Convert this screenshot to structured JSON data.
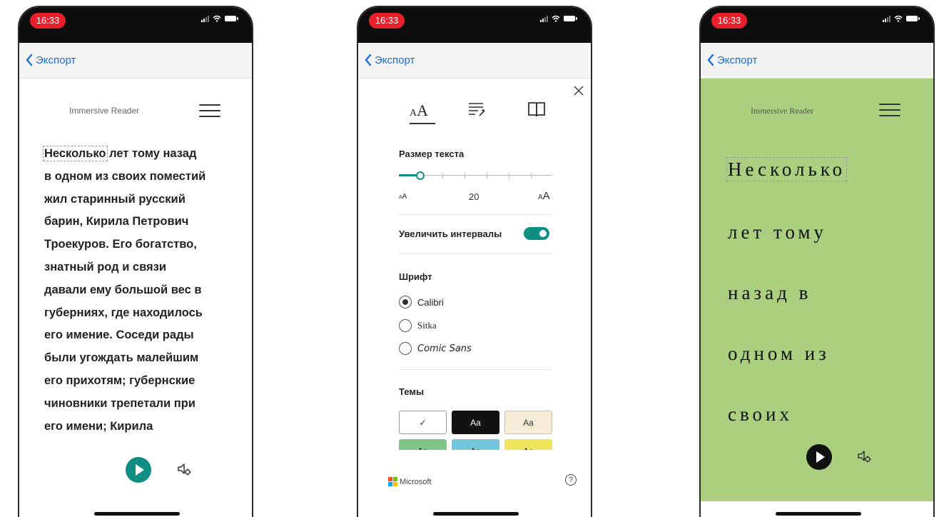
{
  "status_bar": {
    "time": "16:33"
  },
  "nav": {
    "back_label": "Экспорт"
  },
  "reader": {
    "title": "Immersive Reader",
    "first_word": "Несколько",
    "passage_rest": " лет тому назад\nв одном из своих поместий\nжил старинный русский\nбарин, Кирила Петрович\nТроекуров. Его богатство,\nзнатный род и связи\nдавали ему большой вес в\nгуберниях, где находилось\nего имение. Соседи рады\nбыли угождать малейшим\nего прихотям; губернские\nчиновники трепетали при\nего имени; Кирила"
  },
  "settings": {
    "text_size_label": "Размер текста",
    "text_size_value": "20",
    "text_size_fraction": 0.14,
    "small_a": "A",
    "big_a": "A",
    "spacing_label": "Увеличить интервалы",
    "spacing_enabled": true,
    "font_label": "Шрифт",
    "fonts": [
      {
        "label": "Calibri",
        "selected": true
      },
      {
        "label": "Sitka",
        "selected": false
      },
      {
        "label": "Comic Sans",
        "selected": false
      }
    ],
    "themes_label": "Темы",
    "themes": [
      {
        "label": "✓",
        "color": "#ffffff",
        "selected": true
      },
      {
        "label": "Aa",
        "color": "#111111"
      },
      {
        "label": "Aa",
        "color": "#f7ecd8"
      },
      {
        "label": "Aa",
        "color": "#7fc488"
      },
      {
        "label": "Aa",
        "color": "#74c6dc"
      },
      {
        "label": "Aa",
        "color": "#efe55d"
      }
    ],
    "brand": "Microsoft",
    "help": "?"
  },
  "focus_view": {
    "title": "Immersive Reader",
    "background": "#a9cf7f",
    "lines": [
      "Несколько",
      "лет тому",
      "назад в",
      "одном из",
      "своих"
    ]
  },
  "colors": {
    "accent": "#0f8f83",
    "link": "#1a6fd6",
    "time_pill": "#e8202a"
  }
}
